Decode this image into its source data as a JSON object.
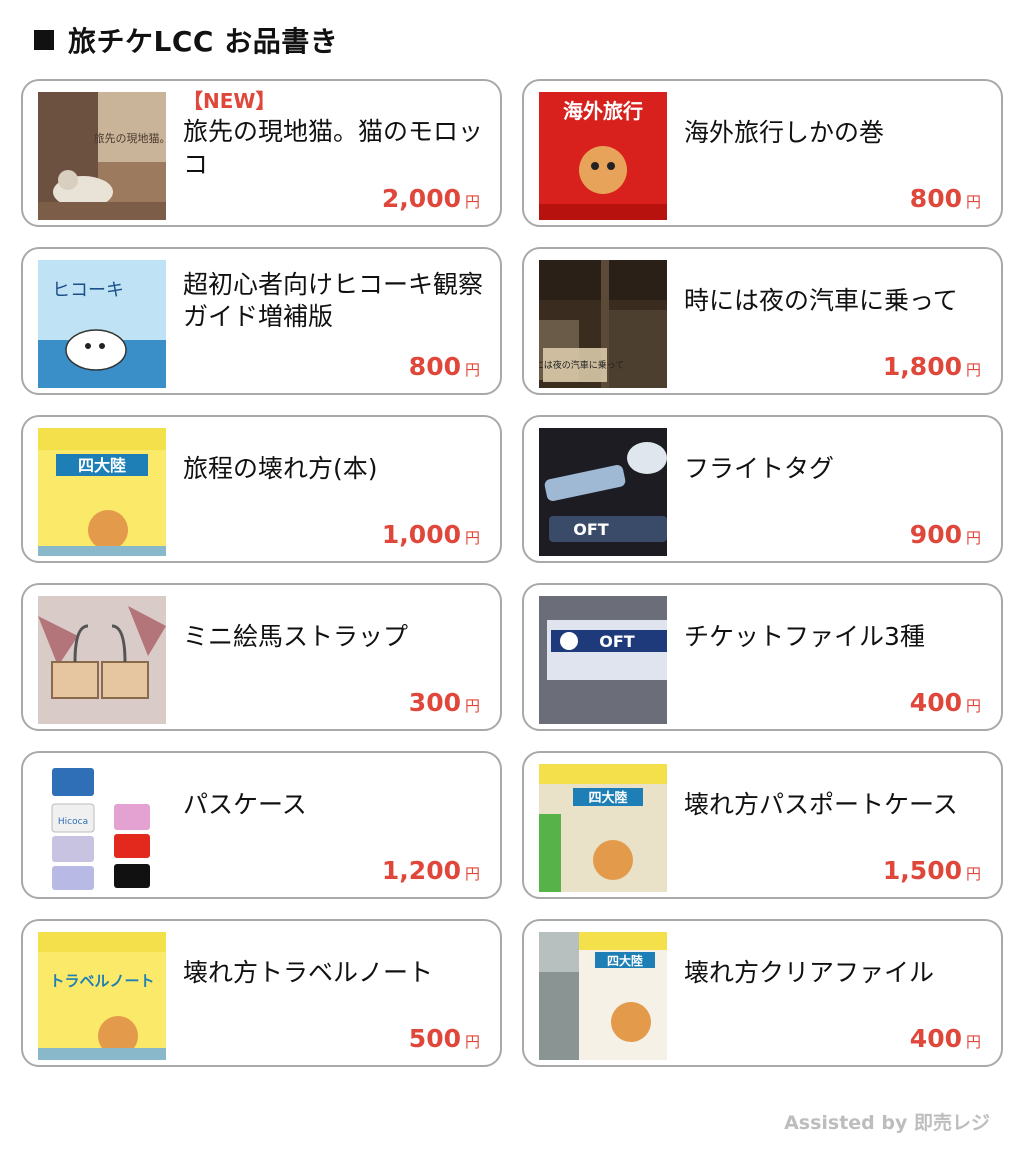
{
  "header": {
    "title": "旅チケLCC お品書き"
  },
  "yen_label": "円",
  "items": [
    {
      "badge": "【NEW】",
      "name": "旅先の現地猫。猫のモロッコ",
      "price": "2,000",
      "thumb_caption": "旅先の現地猫。"
    },
    {
      "badge": "",
      "name": "海外旅行しかの巻",
      "price": "800",
      "thumb_caption": "海外旅行"
    },
    {
      "badge": "",
      "name": "超初心者向けヒコーキ観察ガイド増補版",
      "price": "800",
      "thumb_caption": "ヒコーキ"
    },
    {
      "badge": "",
      "name": "時には夜の汽車に乗って",
      "price": "1,800",
      "thumb_caption": "時には夜の汽車に乗って"
    },
    {
      "badge": "",
      "name": "旅程の壊れ方(本)",
      "price": "1,000",
      "thumb_caption": "四大陸"
    },
    {
      "badge": "",
      "name": "フライトタグ",
      "price": "900",
      "thumb_caption": "OFT"
    },
    {
      "badge": "",
      "name": "ミニ絵馬ストラップ",
      "price": "300",
      "thumb_caption": ""
    },
    {
      "badge": "",
      "name": "チケットファイル3種",
      "price": "400",
      "thumb_caption": "OFT"
    },
    {
      "badge": "",
      "name": "パスケース",
      "price": "1,200",
      "thumb_caption": "Hicoca"
    },
    {
      "badge": "",
      "name": "壊れ方パスポートケース",
      "price": "1,500",
      "thumb_caption": "四大陸"
    },
    {
      "badge": "",
      "name": "壊れ方トラベルノート",
      "price": "500",
      "thumb_caption": "トラベルノート"
    },
    {
      "badge": "",
      "name": "壊れ方クリアファイル",
      "price": "400",
      "thumb_caption": "四大陸"
    }
  ],
  "footer": {
    "text": "Assisted by 即売レジ"
  }
}
